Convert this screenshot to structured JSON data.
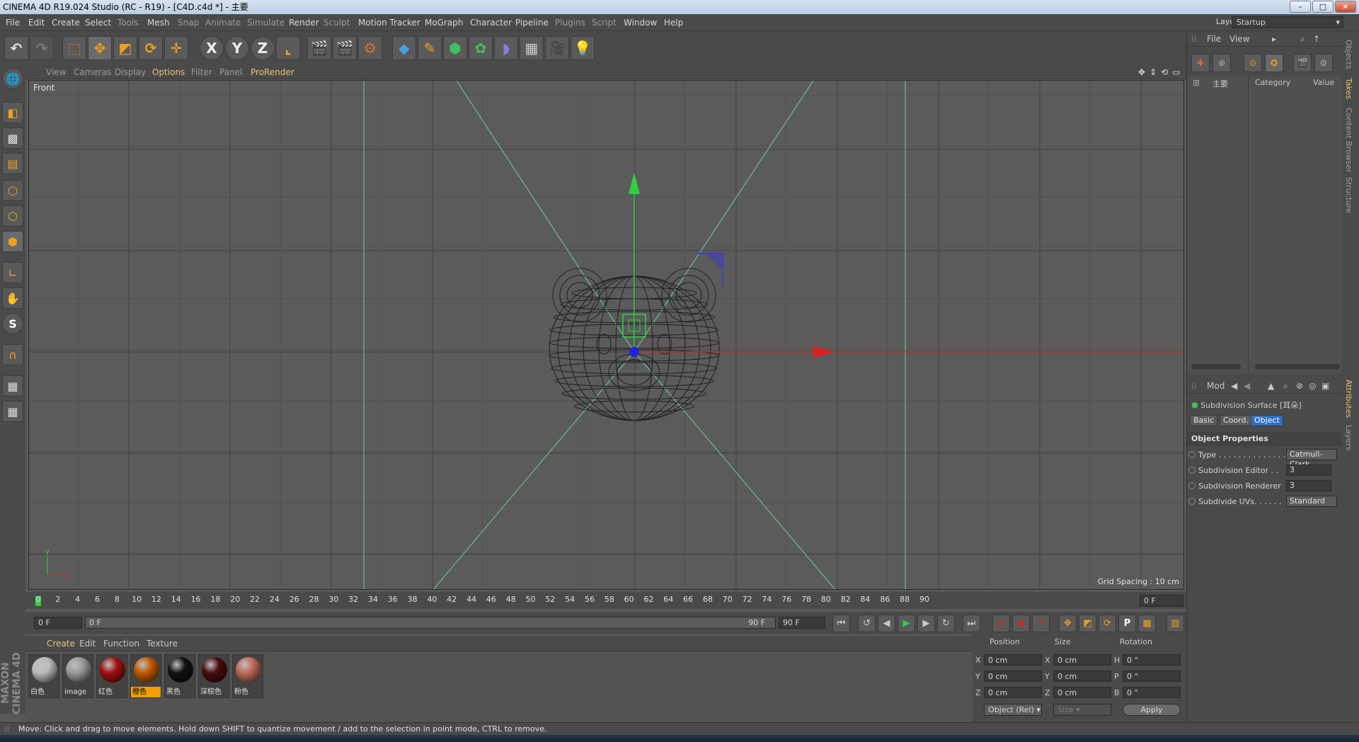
{
  "window": {
    "title": "CINEMA 4D R19.024 Studio (RC - R19) - [C4D.c4d *] - 主要"
  },
  "menu": {
    "items": [
      "File",
      "Edit",
      "Create",
      "Select",
      "Tools",
      "Mesh",
      "Snap",
      "Animate",
      "Simulate",
      "Render",
      "Sculpt",
      "Motion Tracker",
      "MoGraph",
      "Character",
      "Pipeline",
      "Plugins",
      "Script",
      "Window",
      "Help"
    ],
    "layout_label": "Layout:",
    "layout_value": "Startup"
  },
  "toolbar": {
    "axis_x": "X",
    "axis_y": "Y",
    "axis_z": "Z"
  },
  "viewport": {
    "menu": [
      "View",
      "Cameras",
      "Display",
      "Options",
      "Filter",
      "Panel",
      "ProRender"
    ],
    "view_name": "Front",
    "grid_spacing": "Grid Spacing : 10 cm",
    "axis_y": "y",
    "axis_x": "x"
  },
  "timeline": {
    "ticks": [
      "0",
      "2",
      "4",
      "6",
      "8",
      "10",
      "12",
      "14",
      "16",
      "18",
      "20",
      "22",
      "24",
      "26",
      "28",
      "30",
      "32",
      "34",
      "36",
      "38",
      "40",
      "42",
      "44",
      "46",
      "48",
      "50",
      "52",
      "54",
      "56",
      "58",
      "60",
      "62",
      "64",
      "66",
      "68",
      "70",
      "72",
      "74",
      "76",
      "78",
      "80",
      "82",
      "84",
      "86",
      "88",
      "90"
    ],
    "current_frame": "0 F",
    "start_field": "0 F",
    "range_start": "0 F",
    "range_end": "90 F",
    "end_field": "90 F"
  },
  "materials": {
    "menu": [
      "Create",
      "Edit",
      "Function",
      "Texture"
    ],
    "items": [
      {
        "label": "白色",
        "color": "#bcbcbc"
      },
      {
        "label": "image",
        "color": "#9a9a9a"
      },
      {
        "label": "红色",
        "color": "#a01010"
      },
      {
        "label": "橙色",
        "color": "#c05800"
      },
      {
        "label": "黑色",
        "color": "#111111"
      },
      {
        "label": "深棕色",
        "color": "#4a0c0c"
      },
      {
        "label": "粉色",
        "color": "#c06a5a"
      }
    ],
    "selected_index": 3
  },
  "coords": {
    "headers": {
      "position": "Position",
      "size": "Size",
      "rotation": "Rotation"
    },
    "rows": [
      {
        "pa": "X",
        "pv": "0 cm",
        "sa": "X",
        "sv": "0 cm",
        "ra": "H",
        "rv": "0 °"
      },
      {
        "pa": "Y",
        "pv": "0 cm",
        "sa": "Y",
        "sv": "0 cm",
        "ra": "P",
        "rv": "0 °"
      },
      {
        "pa": "Z",
        "pv": "0 cm",
        "sa": "Z",
        "sv": "0 cm",
        "ra": "B",
        "rv": "0 °"
      }
    ],
    "mode": "Object (Rel)",
    "size_mode": "Size",
    "apply": "Apply"
  },
  "takes": {
    "menu": [
      "File",
      "View"
    ],
    "col_main": "主要",
    "col_category": "Category",
    "col_value": "Value"
  },
  "attributes": {
    "mode_label": "Mod",
    "object_title": "Subdivision Surface [耳朵]",
    "tabs": [
      "Basic",
      "Coord.",
      "Object"
    ],
    "active_tab": "Object",
    "section": "Object Properties",
    "props": [
      {
        "label": "Type . . . . . . . . . . . . . . .",
        "value": "Catmull-Clark"
      },
      {
        "label": "Subdivision Editor . .",
        "value": "3"
      },
      {
        "label": "Subdivision Renderer",
        "value": "3"
      },
      {
        "label": "Subdivide UVs. . . . . .",
        "value": "Standard"
      }
    ]
  },
  "side_tabs": [
    "Objects",
    "Takes",
    "Content Browser",
    "Structure",
    "Attributes",
    "Layers"
  ],
  "status": "Move: Click and drag to move elements. Hold down SHIFT to quantize movement / add to the selection in point mode, CTRL to remove."
}
